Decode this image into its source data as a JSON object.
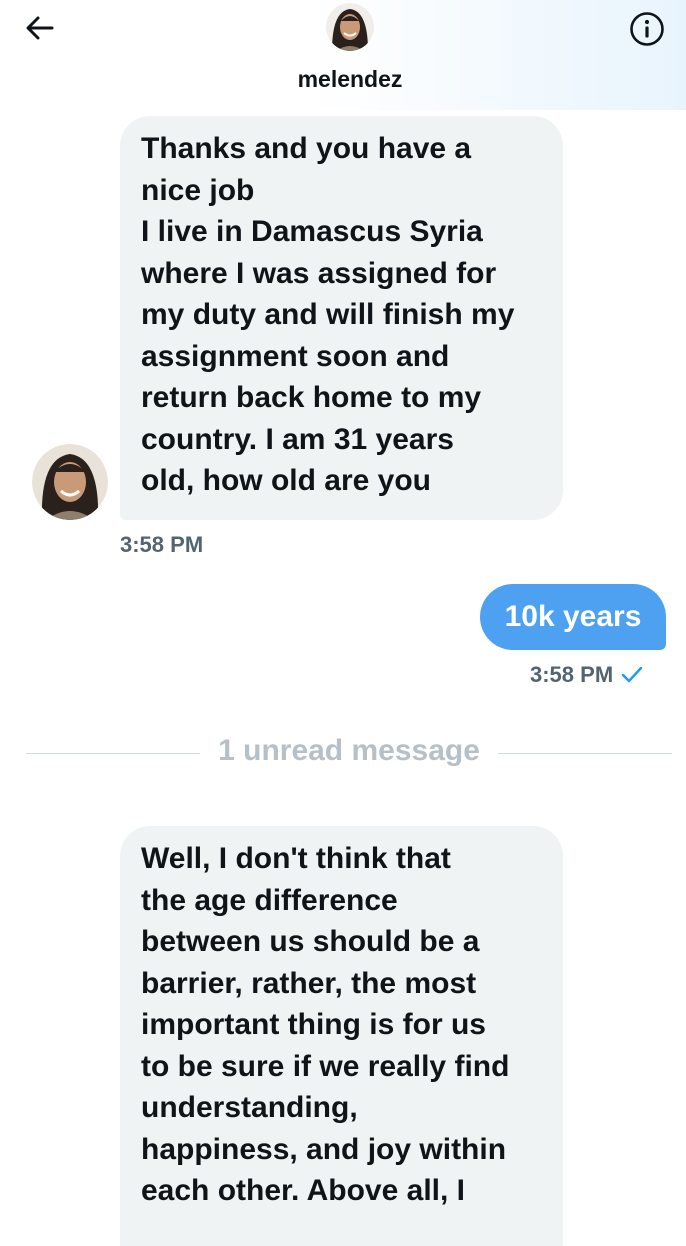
{
  "header": {
    "contact_name": "melendez",
    "back_icon": "arrow-left-icon",
    "info_icon": "info-circle-icon"
  },
  "messages": [
    {
      "direction": "incoming",
      "text": "Thanks and you have a\nnice job\nI live in Damascus Syria\nwhere I was assigned for\nmy duty and will finish my\nassignment soon and\nreturn back home to my\ncountry. I am 31 years\nold, how old are you",
      "time": "3:58 PM"
    },
    {
      "direction": "outgoing",
      "text": "10k years",
      "time": "3:58 PM",
      "status_icon": "checkmark-icon"
    },
    {
      "direction": "incoming",
      "text": "Well, I don't think that\nthe age difference\nbetween us should be a\nbarrier, rather, the most\nimportant thing is for us\nto be sure if we really find\nunderstanding,\nhappiness, and joy within\neach other. Above all, I"
    }
  ],
  "divider": {
    "label": "1 unread message"
  },
  "colors": {
    "incoming_bubble": "#eff3f4",
    "outgoing_bubble": "#4da1f0",
    "timestamp": "#536471",
    "accent": "#1d9bf0"
  }
}
